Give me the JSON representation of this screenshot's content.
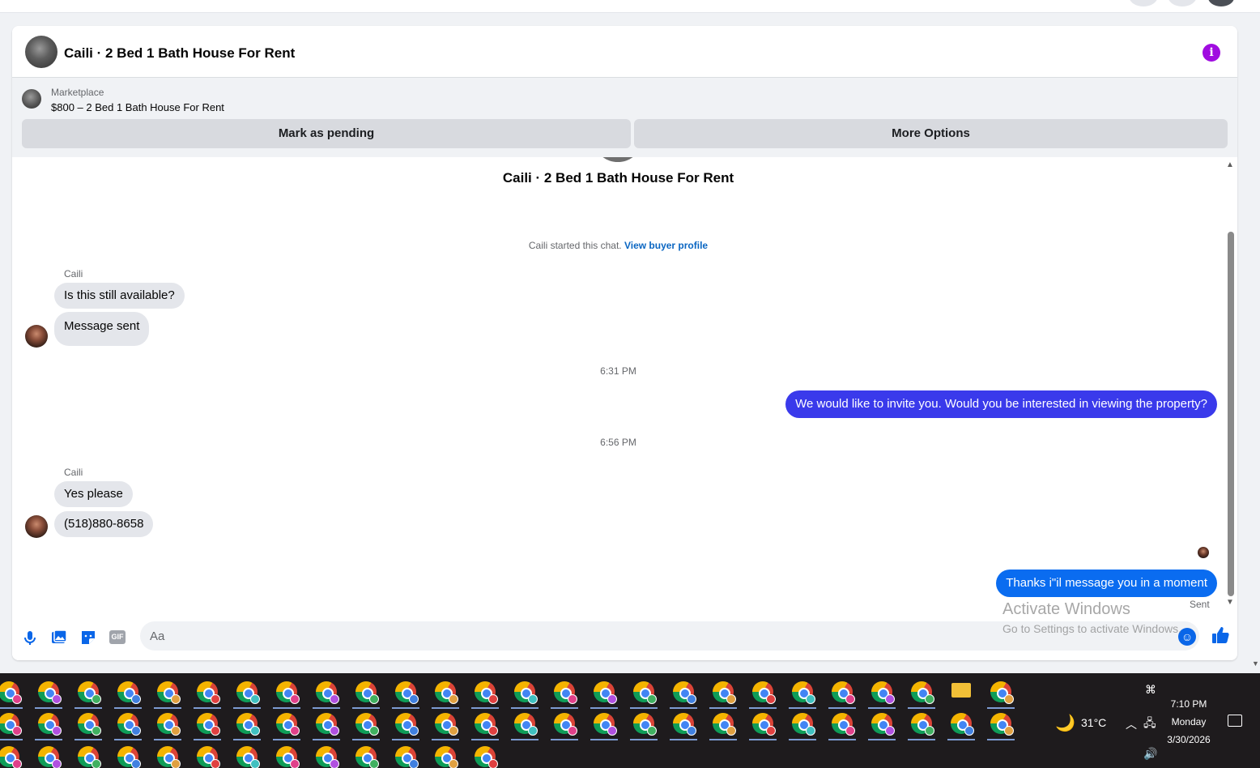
{
  "header": {
    "title": "Caili · 2 Bed 1 Bath House For Rent",
    "info_icon": "info-icon"
  },
  "marketplace": {
    "label": "Marketplace",
    "listing": "$800 – 2 Bed 1 Bath House For Rent",
    "mark_pending": "Mark as pending",
    "more_options": "More Options"
  },
  "conversation": {
    "title": "Caili · 2 Bed 1 Bath House For Rent",
    "started_text": "Caili started this chat.",
    "view_profile": "View buyer profile",
    "groups": [
      {
        "sender": "Caili",
        "messages": [
          "Is this still available?",
          "Message sent"
        ]
      },
      {
        "sender": "Caili",
        "messages": [
          "Yes please",
          "(518)880-8658"
        ]
      }
    ],
    "timestamps": [
      "6:31 PM",
      "6:56 PM"
    ],
    "outgoing": [
      "We would like to invite you. Would you be interested in viewing the property?",
      "Thanks i\"il message you in a moment"
    ],
    "sent_status": "Sent"
  },
  "composer": {
    "placeholder": "Aa",
    "gif_label": "GIF"
  },
  "watermark": {
    "line1": "Activate Windows",
    "line2": "Go to Settings to activate Windows."
  },
  "taskbar": {
    "temperature": "31°C",
    "time": "7:10 PM",
    "day": "Monday",
    "date": "3/30/2026"
  },
  "colors": {
    "outgoing_bubble": "#3a3aeb",
    "outgoing_bubble_latest": "#0a6cf0",
    "incoming_bubble": "#e4e6eb",
    "link": "#0a66c2",
    "info": "#a00ce0",
    "composer_icons": "#0a66e8"
  }
}
